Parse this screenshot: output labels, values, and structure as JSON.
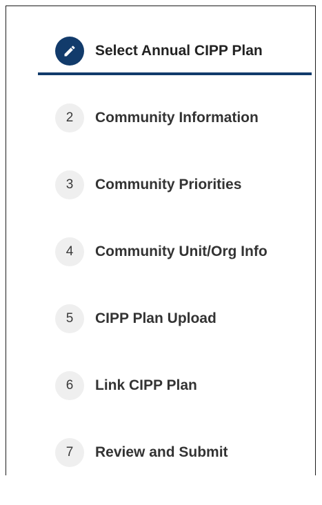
{
  "stepper": {
    "steps": [
      {
        "number": "",
        "label": "Select Annual CIPP Plan",
        "state": "active",
        "icon": "pencil-icon"
      },
      {
        "number": "2",
        "label": "Community Information",
        "state": "pending"
      },
      {
        "number": "3",
        "label": "Community Priorities",
        "state": "pending"
      },
      {
        "number": "4",
        "label": "Community Unit/Org Info",
        "state": "pending"
      },
      {
        "number": "5",
        "label": "CIPP Plan Upload",
        "state": "pending"
      },
      {
        "number": "6",
        "label": "Link CIPP Plan",
        "state": "pending"
      },
      {
        "number": "7",
        "label": "Review and Submit",
        "state": "pending"
      }
    ],
    "colors": {
      "active": "#123b6b",
      "pending_marker_bg": "#efefef",
      "text": "#333333"
    }
  }
}
